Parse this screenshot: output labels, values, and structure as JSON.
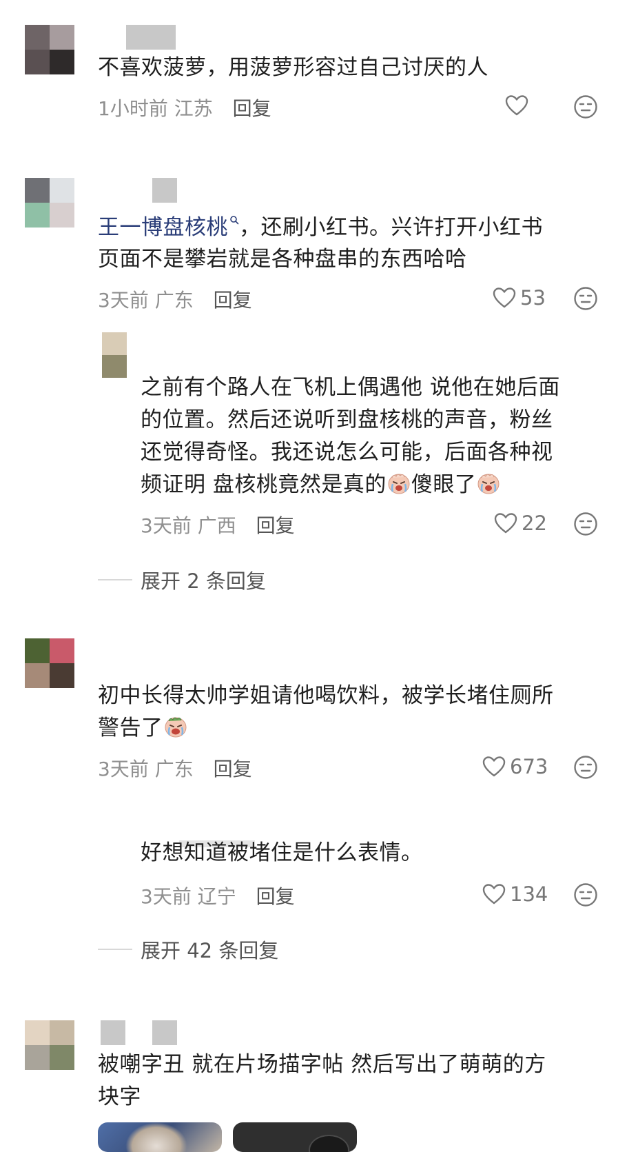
{
  "comments": [
    {
      "text": "不喜欢菠萝，用菠萝形容过自己讨厌的人",
      "time": "1小时前",
      "location": "江苏",
      "reply": "回复",
      "likes": ""
    },
    {
      "mention": "王一博盘核桃",
      "text_after_mention": "，还刷小红书。兴许打开小红书",
      "text_line2": "页面不是攀岩就是各种盘串的东西哈哈",
      "time": "3天前",
      "location": "广东",
      "reply": "回复",
      "likes": "53"
    },
    {
      "lines": [
        "之前有个路人在飞机上偶遇他 说他在她后面",
        "的位置。然后还说听到盘核桃的声音，粉丝",
        "还觉得奇怪。我还说怎么可能，后面各种视"
      ],
      "line4_a": "频证明 盘核桃竟然是真的",
      "line4_b": "傻眼了",
      "time": "3天前",
      "location": "广西",
      "reply": "回复",
      "likes": "22"
    },
    {
      "text_line1": "初中长得太帅学姐请他喝饮料，被学长堵住厕所",
      "text_line2": "警告了",
      "time": "3天前",
      "location": "广东",
      "reply": "回复",
      "likes": "673"
    },
    {
      "text": "好想知道被堵住是什么表情。",
      "time": "3天前",
      "location": "辽宁",
      "reply": "回复",
      "likes": "134"
    },
    {
      "text_line1": "被嘲字丑 就在片场描字帖 然后写出了萌萌的方",
      "text_line2": "块字"
    }
  ],
  "expand_links": [
    "展开 2 条回复",
    "展开 42 条回复"
  ],
  "icons": {
    "like": "heart-outline-icon",
    "dislike": "sad-face-icon",
    "emoji": "crying-face-emoji"
  },
  "colors": {
    "text": "#1f1f1f",
    "meta": "#8f8f8f",
    "mention": "#2a3d78",
    "icon": "#777777"
  }
}
